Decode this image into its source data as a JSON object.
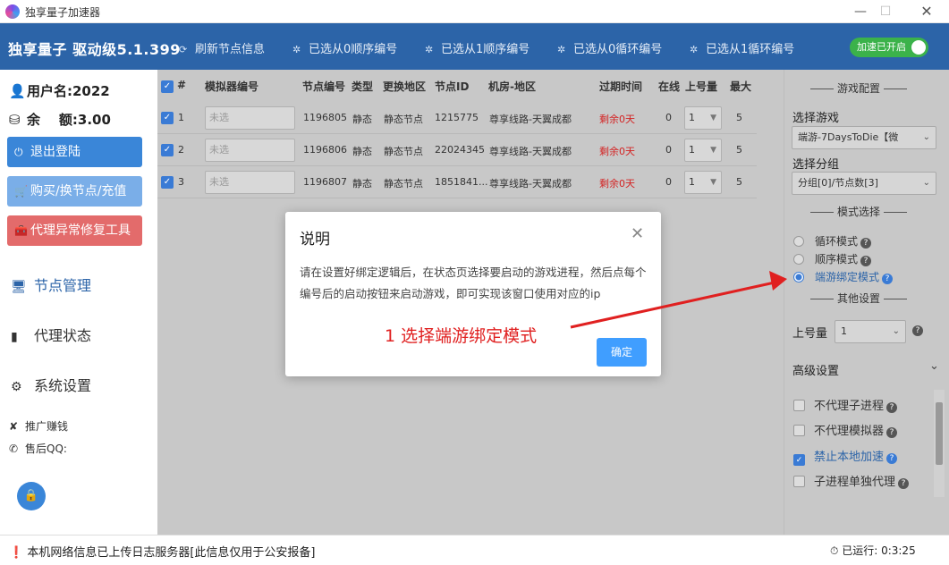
{
  "window": {
    "title": "独享量子加速器",
    "min_icon": "minimize-icon",
    "max_icon": "maximize-icon",
    "close_icon": "close-icon"
  },
  "toolbar": {
    "brand": "独享量子 驱动级5.1.399",
    "items": [
      {
        "icon": "refresh-icon",
        "label": "刷新节点信息"
      },
      {
        "icon": "spinner-icon",
        "label": "已选从0顺序编号"
      },
      {
        "icon": "spinner-icon",
        "label": "已选从1顺序编号"
      },
      {
        "icon": "spinner-icon",
        "label": "已选从0循环编号"
      },
      {
        "icon": "spinner-icon",
        "label": "已选从1循环编号"
      }
    ],
    "accel_toggle": "加速已开启",
    "accel_color": "#3bb24a"
  },
  "sidebar": {
    "username": "用户名:2022",
    "balance": "余    额:3.00",
    "buttons": {
      "logout": "退出登陆",
      "buy": "购买/换节点/充值",
      "repair": "代理异常修复工具"
    },
    "nav": {
      "nodes": "节点管理",
      "proxy": "代理状态",
      "settings": "系统设置"
    },
    "promo": "推广赚钱",
    "support": "售后QQ:"
  },
  "table": {
    "headers": [
      "#",
      "模拟器编号",
      "节点编号",
      "类型",
      "更换地区",
      "节点ID",
      "机房-地区",
      "过期时间",
      "在线",
      "上号量",
      "最大"
    ],
    "placeholder": "未选",
    "rows": [
      {
        "idx": "1",
        "node": "1196805",
        "type": "静态",
        "region": "静态节点",
        "node_id": "1215775",
        "room": "尊享线路-天翼成都",
        "expire": "剩余0天",
        "online": "0",
        "qty": "1",
        "max": "5"
      },
      {
        "idx": "2",
        "node": "1196806",
        "type": "静态",
        "region": "静态节点",
        "node_id": "22024345",
        "room": "尊享线路-天翼成都",
        "expire": "剩余0天",
        "online": "0",
        "qty": "1",
        "max": "5"
      },
      {
        "idx": "3",
        "node": "1196807",
        "type": "静态",
        "region": "静态节点",
        "node_id": "1851841...",
        "room": "尊享线路-天翼成都",
        "expire": "剩余0天",
        "online": "0",
        "qty": "1",
        "max": "5"
      }
    ]
  },
  "right_panel": {
    "game_config_title": "游戏配置",
    "select_game_label": "选择游戏",
    "selected_game": "端游-7DaysToDie【微",
    "select_group_label": "选择分组",
    "selected_group": "分组[0]/节点数[3]",
    "mode_title": "模式选择",
    "modes": [
      {
        "label": "循环模式",
        "selected": false
      },
      {
        "label": "顺序模式",
        "selected": false
      },
      {
        "label": "端游绑定模式",
        "selected": true
      }
    ],
    "other_title": "其他设置",
    "qty_label": "上号量",
    "qty_value": "1",
    "advanced_label": "高级设置",
    "options": [
      {
        "label": "不代理子进程",
        "checked": false
      },
      {
        "label": "不代理模拟器",
        "checked": false
      },
      {
        "label": "禁止本地加速",
        "checked": true
      },
      {
        "label": "子进程单独代理",
        "checked": false
      }
    ]
  },
  "status": {
    "message": "本机网络信息已上传日志服务器[此信息仅用于公安报备]",
    "runtime_label": "已运行:",
    "runtime_value": "0:3:25"
  },
  "dialog": {
    "title": "说明",
    "body": "请在设置好绑定逻辑后，在状态页选择要启动的游戏进程，然后点每个编号后的启动按钮来启动游戏，即可实现该窗口使用对应的ip",
    "ok": "确定",
    "ok_color": "#409eff"
  },
  "annotation": {
    "text": "1 选择端游绑定模式",
    "color": "#e02020"
  }
}
